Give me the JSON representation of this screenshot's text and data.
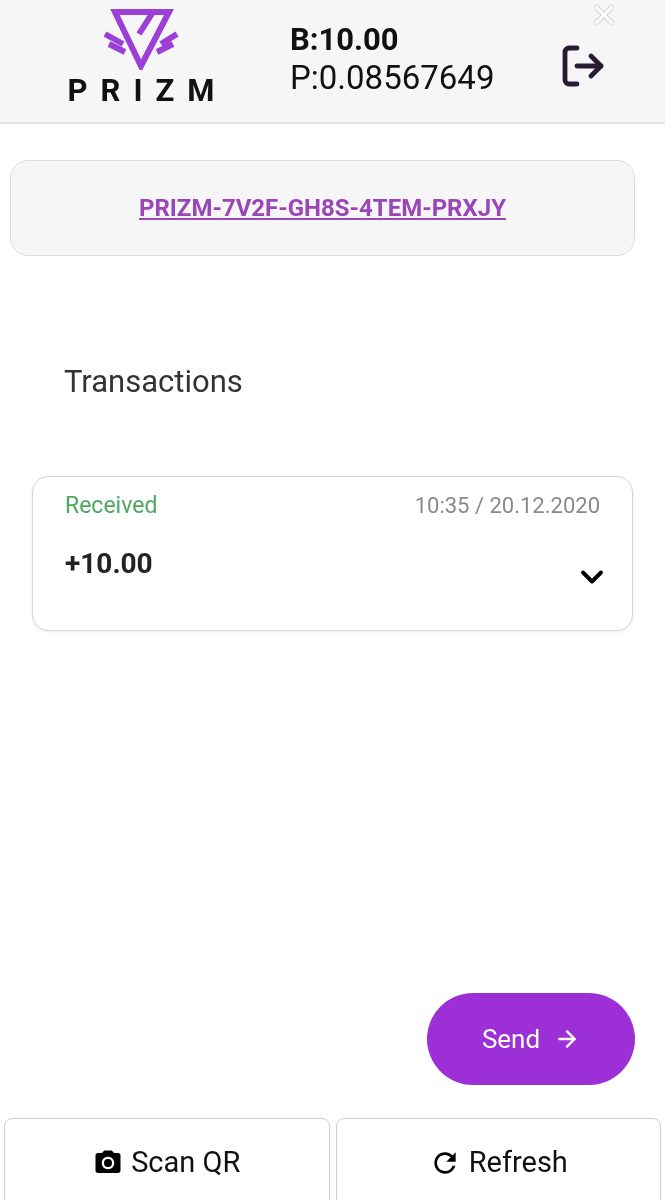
{
  "header": {
    "logo_text": "PRIZM",
    "balance": "B:10.00",
    "price": "P:0.08567649"
  },
  "address": {
    "text": "PRIZM-7V2F-GH8S-4TEM-PRXJY"
  },
  "transactions": {
    "title": "Transactions",
    "items": [
      {
        "kind": "received",
        "status": "Received",
        "time": "10:35 / 20.12.2020",
        "amount": "+10.00",
        "expanded": false
      }
    ]
  },
  "send_button": {
    "label": "Send"
  },
  "bottom_bar": [
    {
      "kind": "scan",
      "label": "Scan QR"
    },
    {
      "kind": "refresh",
      "label": "Refresh"
    }
  ]
}
